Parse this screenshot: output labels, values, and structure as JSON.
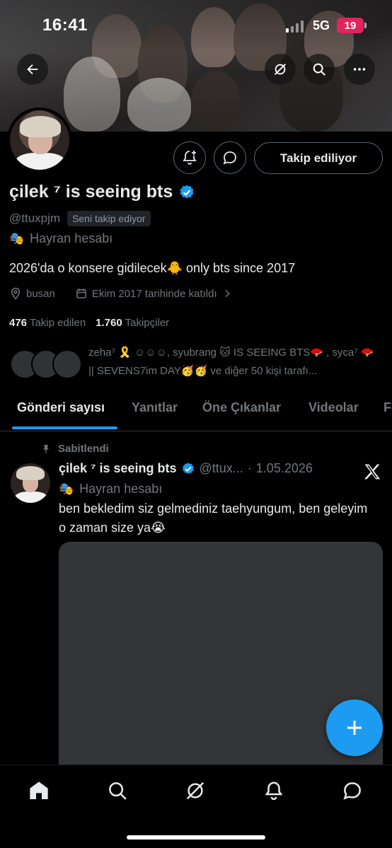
{
  "status_bar": {
    "time": "16:41",
    "network": "5G",
    "battery": "19"
  },
  "profile": {
    "name": "çilek ⁷ is seeing bts",
    "handle": "@ttuxpjm",
    "follows_you_badge": "Seni takip ediyor",
    "account_label": "Hayran hesabı",
    "bio": "2026'da o konsere gidilecek🐥 only bts since 2017",
    "location": "busan",
    "joined": "Ekim 2017 tarihinde katıldı",
    "following_count": "476",
    "following_label": "Takip edilen",
    "followers_count": "1.760",
    "followers_label": "Takipçiler",
    "follow_button": "Takip ediliyor",
    "mutuals_text": "zeha⁷ 🎗️ ☺︎☺︎☺︎, syubrang 🐱 IS SEEING BTS🪭 , syca⁷ 🪭 || SEVENS7im DAY🥳🥳 ve diğer 50 kişi tarafı..."
  },
  "tabs": [
    {
      "label": "Gönderi sayısı",
      "active": true
    },
    {
      "label": "Yanıtlar",
      "active": false
    },
    {
      "label": "Öne Çıkanlar",
      "active": false
    },
    {
      "label": "Videolar",
      "active": false
    },
    {
      "label": "Fo",
      "active": false
    }
  ],
  "pinned_tweet": {
    "pinned_label": "Sabitlendi",
    "name": "çilek ⁷ is seeing bts",
    "handle": "@ttux...",
    "separator": "·",
    "date": "1.05.2026",
    "account_label": "Hayran hesabı",
    "text": "ben bekledim siz gelmediniz taehyungum, ben geleyim o zaman size ya😭"
  },
  "colors": {
    "accent": "#1d9bf0",
    "muted": "#71767b",
    "text": "#e7e9ea",
    "border": "#2f3336",
    "battery": "#e0245e"
  },
  "icons": {
    "header": [
      "back-arrow-icon",
      "grok-icon",
      "search-icon",
      "more-icon"
    ],
    "profile_actions": [
      "notification-bell-plus-icon",
      "message-icon"
    ],
    "nav": [
      "home-icon",
      "search-icon",
      "grok-icon",
      "notifications-icon",
      "messages-icon"
    ]
  }
}
